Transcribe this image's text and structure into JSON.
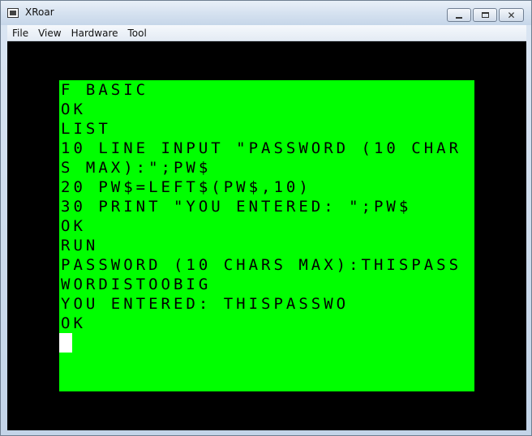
{
  "window": {
    "title": "XRoar"
  },
  "menu": {
    "items": [
      "File",
      "View",
      "Hardware",
      "Tool"
    ]
  },
  "screen": {
    "lines": [
      "F BASIC",
      "OK",
      "LIST",
      "10 LINE INPUT \"PASSWORD (10 CHAR",
      "S MAX):\";PW$",
      "20 PW$=LEFT$(PW$,10)",
      "30 PRINT \"YOU ENTERED: \";PW$",
      "OK",
      "RUN",
      "PASSWORD (10 CHARS MAX):THISPASS",
      "WORDISTOOBIG",
      "YOU ENTERED: THISPASSWO",
      "OK"
    ],
    "background": "#00ff00",
    "border": "#000000",
    "cursor_color": "#ffffff"
  },
  "icons": {
    "app": "xroar-app-icon",
    "minimize": "minimize-icon",
    "maximize": "maximize-icon",
    "close": "close-icon"
  }
}
